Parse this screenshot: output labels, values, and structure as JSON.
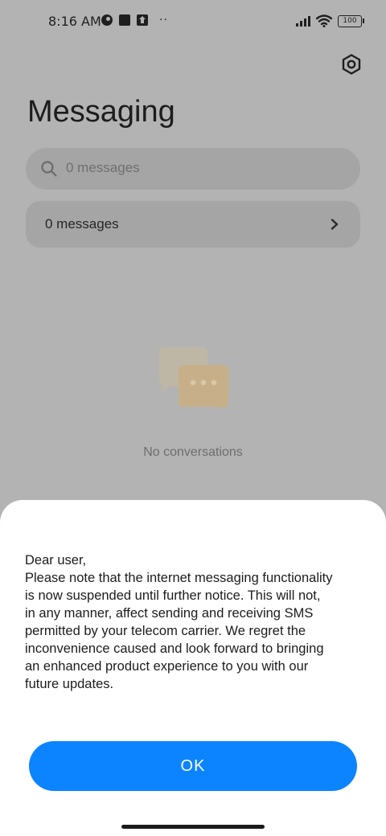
{
  "status_bar": {
    "time": "8:16 AM",
    "dots": "··",
    "battery": "100"
  },
  "header": {
    "title": "Messaging"
  },
  "search": {
    "placeholder": "0 messages"
  },
  "messages_row": {
    "label": "0 messages"
  },
  "empty_state": {
    "text": "No conversations"
  },
  "dialog": {
    "message": "Dear user,\nPlease note that the internet messaging functionality\nis now suspended until further notice. This will not,\nin any manner, affect sending and receiving SMS\npermitted by your telecom carrier. We regret the\ninconvenience caused and look forward to bringing\nan enhanced product experience to you with our\nfuture updates.",
    "ok_label": "OK"
  },
  "colors": {
    "accent": "#0d84ff",
    "scrim": "#b3b3b3",
    "sheet": "#ffffff"
  },
  "icons": {
    "settings": "settings-icon",
    "search": "search-icon",
    "chevron": "chevron-right-icon",
    "empty": "chat-bubbles-icon"
  }
}
